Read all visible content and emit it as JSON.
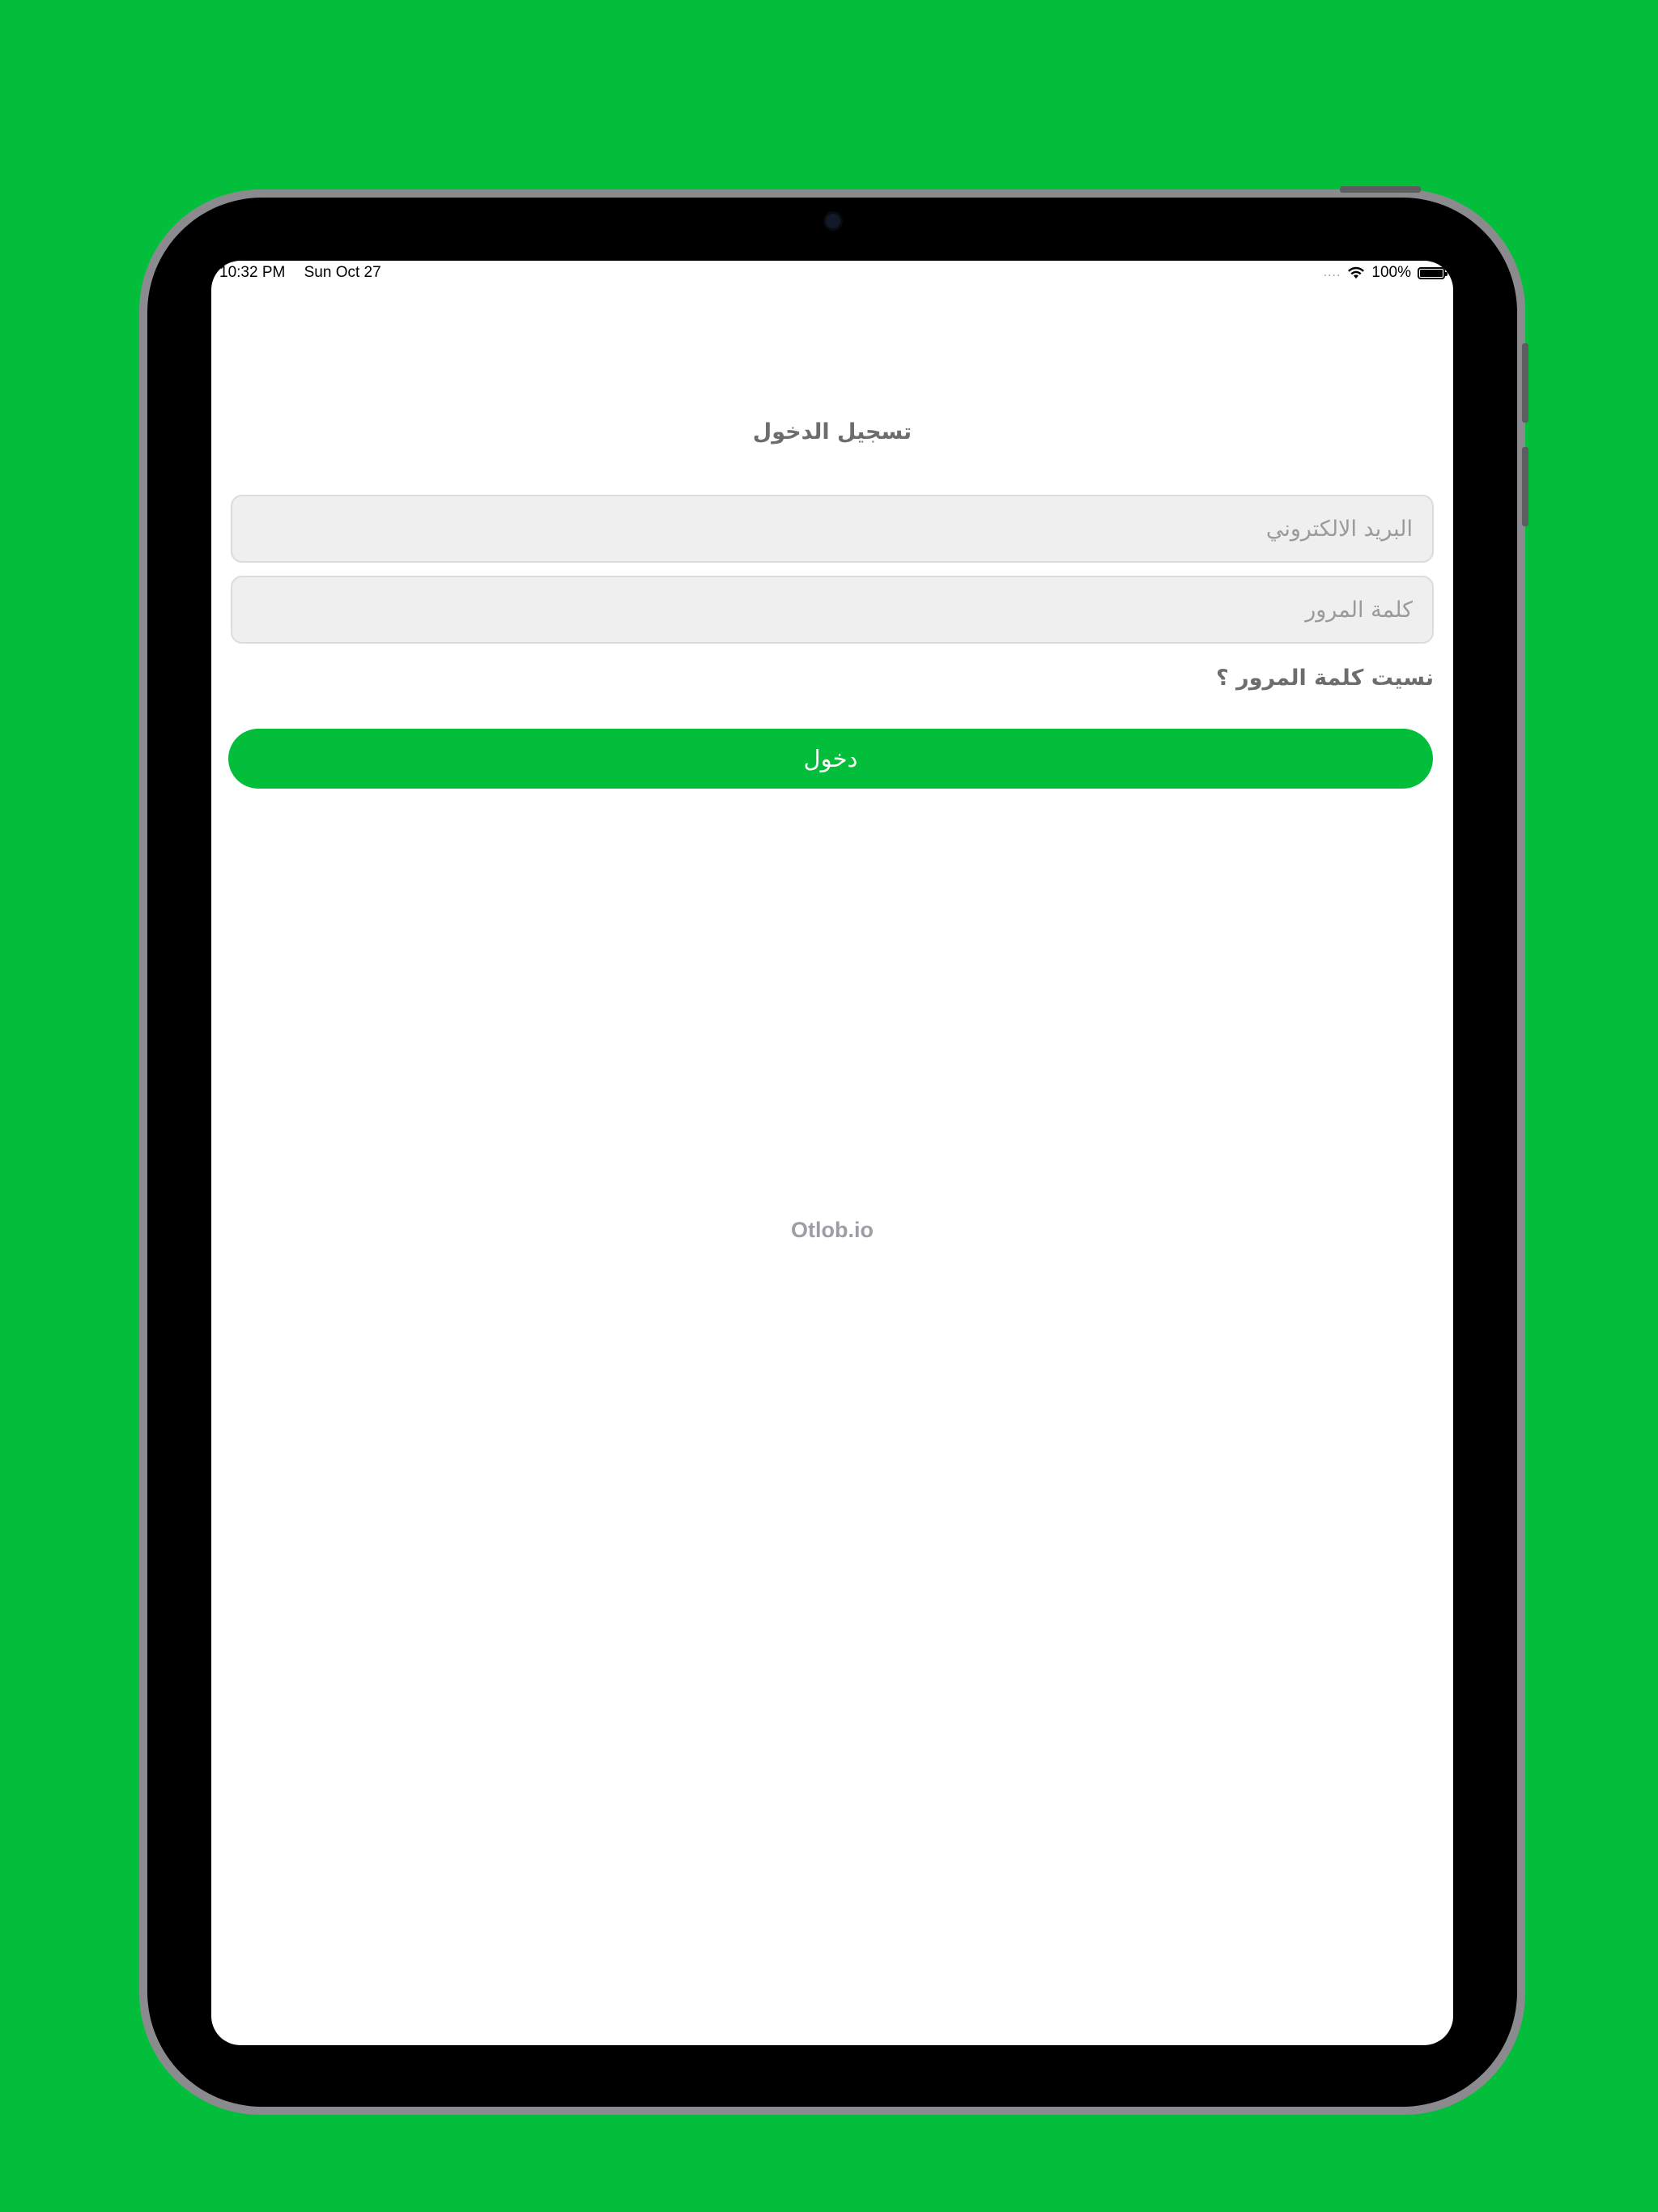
{
  "status_bar": {
    "time": "10:32 PM",
    "date": "Sun Oct 27",
    "signal": "....",
    "battery": "100%",
    "battery_level": 1.0
  },
  "login": {
    "title": "تسجيل الدخول",
    "email_placeholder": "البريد الالكتروني",
    "email_value": "",
    "password_placeholder": "كلمة المرور",
    "password_value": "",
    "forgot_password": "نسيت كلمة المرور ؟",
    "submit_label": "دخول"
  },
  "footer": {
    "brand": "Otlob.io"
  },
  "colors": {
    "background": "#03BE3A",
    "accent": "#03BE3A",
    "field_bg": "#EFEFEF",
    "muted_text": "#6D6D6D"
  }
}
